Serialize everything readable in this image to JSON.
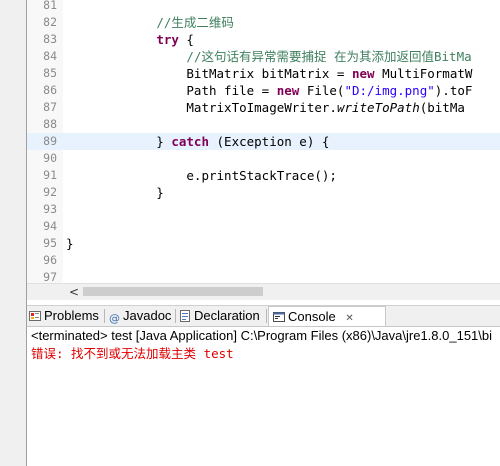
{
  "editor": {
    "lines": [
      {
        "num": "81",
        "segments": []
      },
      {
        "num": "82",
        "segments": [
          {
            "t": "            ",
            "c": ""
          },
          {
            "t": "//生成二维码",
            "c": "cm"
          }
        ]
      },
      {
        "num": "83",
        "segments": [
          {
            "t": "            ",
            "c": ""
          },
          {
            "t": "try",
            "c": "kw"
          },
          {
            "t": " {",
            "c": ""
          }
        ]
      },
      {
        "num": "84",
        "segments": [
          {
            "t": "                ",
            "c": ""
          },
          {
            "t": "//这句话有异常需要捕捉 在为其添加返回值BitMa",
            "c": "cm"
          }
        ]
      },
      {
        "num": "85",
        "segments": [
          {
            "t": "                BitMatrix bitMatrix = ",
            "c": ""
          },
          {
            "t": "new",
            "c": "kw"
          },
          {
            "t": " MultiFormatW",
            "c": ""
          }
        ]
      },
      {
        "num": "86",
        "segments": [
          {
            "t": "                Path file = ",
            "c": ""
          },
          {
            "t": "new",
            "c": "kw"
          },
          {
            "t": " File(",
            "c": ""
          },
          {
            "t": "\"D:/img.png\"",
            "c": "st"
          },
          {
            "t": ").toF",
            "c": ""
          }
        ]
      },
      {
        "num": "87",
        "segments": [
          {
            "t": "                MatrixToImageWriter.",
            "c": ""
          },
          {
            "t": "writeToPath",
            "c": "it"
          },
          {
            "t": "(bitMa",
            "c": ""
          }
        ]
      },
      {
        "num": "88",
        "segments": []
      },
      {
        "num": "89",
        "segments": [
          {
            "t": "            } ",
            "c": ""
          },
          {
            "t": "catch",
            "c": "kw"
          },
          {
            "t": " (Exception e) {",
            "c": ""
          }
        ]
      },
      {
        "num": "90",
        "segments": []
      },
      {
        "num": "91",
        "segments": [
          {
            "t": "                e.printStackTrace();",
            "c": ""
          }
        ]
      },
      {
        "num": "92",
        "segments": [
          {
            "t": "            }",
            "c": ""
          }
        ]
      },
      {
        "num": "93",
        "segments": []
      },
      {
        "num": "94",
        "segments": []
      },
      {
        "num": "95",
        "segments": [
          {
            "t": "}",
            "c": ""
          }
        ]
      },
      {
        "num": "96",
        "segments": []
      },
      {
        "num": "97",
        "segments": []
      }
    ],
    "current_line": "89",
    "warning_line": "85",
    "scroll_left_glyph": "<"
  },
  "console": {
    "tabs": [
      {
        "label": "Problems",
        "icon": "problems-icon"
      },
      {
        "label": "Javadoc",
        "icon": "javadoc-icon"
      },
      {
        "label": "Declaration",
        "icon": "declaration-icon"
      },
      {
        "label": "Console",
        "icon": "console-icon",
        "active": true,
        "close": "✕"
      }
    ],
    "status": "<terminated> test [Java Application] C:\\Program Files (x86)\\Java\\jre1.8.0_151\\bi",
    "error": "错误: 找不到或无法加载主类 test"
  }
}
